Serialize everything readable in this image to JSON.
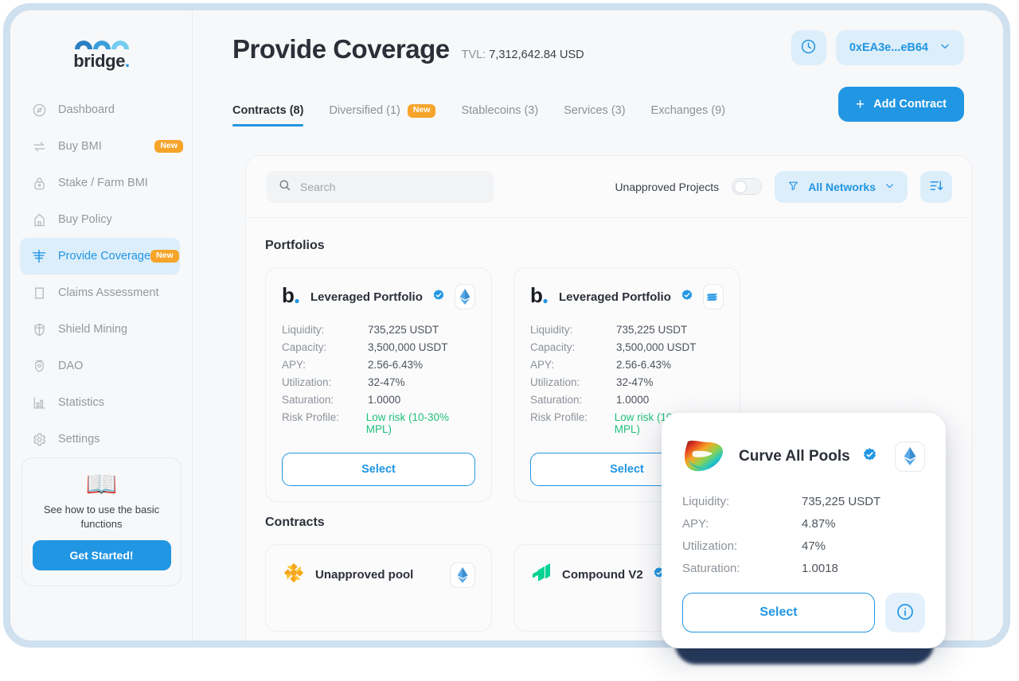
{
  "brand": {
    "name": "bridge",
    "dot": "."
  },
  "sidebar": {
    "items": [
      {
        "label": "Dashboard",
        "icon": "compass-icon",
        "badge": null
      },
      {
        "label": "Buy BMI",
        "icon": "swap-icon",
        "badge": "New"
      },
      {
        "label": "Stake / Farm BMI",
        "icon": "lock-icon",
        "badge": null
      },
      {
        "label": "Buy Policy",
        "icon": "umbrella-icon",
        "badge": null
      },
      {
        "label": "Provide Coverage",
        "icon": "coverage-icon",
        "badge": "New"
      },
      {
        "label": "Claims Assessment",
        "icon": "scroll-icon",
        "badge": null
      },
      {
        "label": "Shield Mining",
        "icon": "shield-icon",
        "badge": null
      },
      {
        "label": "DAO",
        "icon": "dao-icon",
        "badge": null
      },
      {
        "label": "Statistics",
        "icon": "bar-chart-icon",
        "badge": null
      },
      {
        "label": "Settings",
        "icon": "gear-icon",
        "badge": null
      }
    ],
    "promo": {
      "icon": "open-book-icon",
      "text": "See how to use the basic functions",
      "button": "Get Started!"
    }
  },
  "header": {
    "title": "Provide Coverage",
    "tvl_label": "TVL:",
    "tvl_value": "7,312,642.84 USD",
    "history_icon": "clock-icon",
    "wallet": "0xEA3e...eB64",
    "wallet_chevron": "chevron-down-icon",
    "add_contract": "Add Contract",
    "add_icon": "plus-icon"
  },
  "tabs": [
    {
      "label": "Contracts (8)",
      "badge": null,
      "active": true
    },
    {
      "label": "Diversified (1)",
      "badge": "New",
      "active": false
    },
    {
      "label": "Stablecoins (3)",
      "badge": null,
      "active": false
    },
    {
      "label": "Services (3)",
      "badge": null,
      "active": false
    },
    {
      "label": "Exchanges (9)",
      "badge": null,
      "active": false
    }
  ],
  "toolbar": {
    "search_placeholder": "Search",
    "search_value": "",
    "search_icon": "search-icon",
    "toggle_label": "Unapproved Projects",
    "toggle_on": false,
    "networks_label": "All Networks",
    "filter_icon": "funnel-icon",
    "networks_chevron": "chevron-down-icon",
    "sort_icon": "sort-descending-icon"
  },
  "sections": {
    "portfolios_title": "Portfolios",
    "contracts_title": "Contracts"
  },
  "portfolios": [
    {
      "name": "Leveraged Portfolio",
      "logo": "bridge-b-icon",
      "verified": true,
      "chain_icon": "ethereum-icon",
      "stats": [
        {
          "key": "Liquidity:",
          "value": "735,225 USDT",
          "risk": false
        },
        {
          "key": "Capacity:",
          "value": "3,500,000 USDT",
          "risk": false
        },
        {
          "key": "APY:",
          "value": "2.56-6.43%",
          "risk": false
        },
        {
          "key": "Utilization:",
          "value": "32-47%",
          "risk": false
        },
        {
          "key": "Saturation:",
          "value": "1.0000",
          "risk": false
        },
        {
          "key": "Risk Profile:",
          "value": "Low risk (10-30% MPL)",
          "risk": true
        }
      ],
      "select": "Select"
    },
    {
      "name": "Leveraged Portfolio",
      "logo": "bridge-b-icon",
      "verified": true,
      "chain_icon": "bsc-icon",
      "stats": [
        {
          "key": "Liquidity:",
          "value": "735,225 USDT",
          "risk": false
        },
        {
          "key": "Capacity:",
          "value": "3,500,000 USDT",
          "risk": false
        },
        {
          "key": "APY:",
          "value": "2.56-6.43%",
          "risk": false
        },
        {
          "key": "Utilization:",
          "value": "32-47%",
          "risk": false
        },
        {
          "key": "Saturation:",
          "value": "1.0000",
          "risk": false
        },
        {
          "key": "Risk Profile:",
          "value": "Low risk (10-30% MPL)",
          "risk": true
        }
      ],
      "select": "Select"
    }
  ],
  "contracts": [
    {
      "name": "Unapproved pool",
      "logo": "sunflower-icon",
      "verified": false,
      "chain_icon": "ethereum-icon"
    },
    {
      "name": "Compound V2",
      "logo": "compound-icon",
      "verified": true,
      "chain_icon": "ethereum-icon"
    }
  ],
  "popup": {
    "name": "Curve All Pools",
    "logo": "curve-icon",
    "verified": true,
    "chain_icon": "ethereum-icon",
    "stats": [
      {
        "key": "Liquidity:",
        "value": "735,225 USDT"
      },
      {
        "key": "APY:",
        "value": "4.87%"
      },
      {
        "key": "Utilization:",
        "value": "47%"
      },
      {
        "key": "Saturation:",
        "value": "1.0018"
      }
    ],
    "select": "Select",
    "info_icon": "info-icon"
  },
  "colors": {
    "accent": "#2196e3",
    "accent_soft": "#ddeefb",
    "badge_new": "#f6a42a",
    "risk_green": "#21c07a",
    "frame": "#cfe0ef",
    "text_dark": "#2b3038",
    "text_muted": "#8c9299"
  }
}
